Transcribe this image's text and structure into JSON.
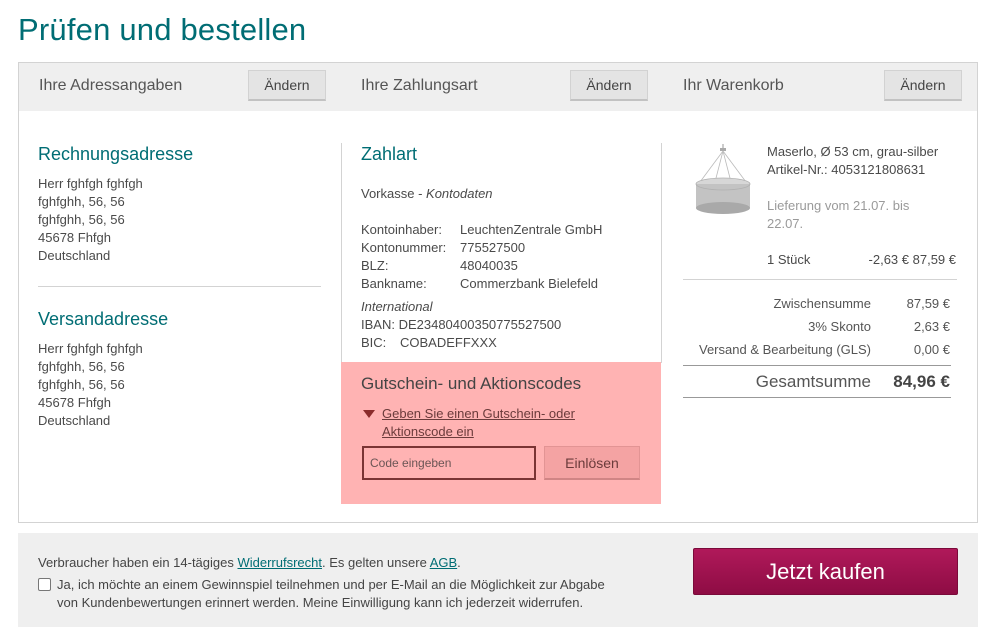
{
  "page_title": "Prüfen und bestellen",
  "steps": {
    "address_label": "Ihre Adressangaben",
    "payment_label": "Ihre Zahlungsart",
    "cart_label": "Ihr Warenkorb",
    "change_label": "Ändern"
  },
  "billing": {
    "heading": "Rechnungsadresse",
    "lines": [
      "Herr fghfgh fghfgh",
      "fghfghh, 56, 56",
      "fghfghh, 56, 56",
      "45678 Fhfgh",
      "Deutschland"
    ]
  },
  "shipping": {
    "heading": "Versandadresse",
    "lines": [
      "Herr fghfgh fghfgh",
      "fghfghh, 56, 56",
      "fghfghh, 56, 56",
      "45678 Fhfgh",
      "Deutschland"
    ]
  },
  "payment": {
    "heading": "Zahlart",
    "method": "Vorkasse - ",
    "method_detail": "Kontodaten",
    "rows": [
      {
        "label": "Kontoinhaber:",
        "value": "LeuchtenZentrale GmbH"
      },
      {
        "label": "Kontonummer:",
        "value": "775527500"
      },
      {
        "label": "BLZ:",
        "value": "48040035"
      },
      {
        "label": "Bankname:",
        "value": "Commerzbank Bielefeld"
      }
    ],
    "international_heading": "International",
    "iban": "IBAN: DE23480400350775527500",
    "bic_label": "BIC:",
    "bic_value": "COBADEFFXXX"
  },
  "coupon": {
    "heading": "Gutschein- und Aktionscodes",
    "link_line1": "Geben Sie einen Gutschein- oder",
    "link_line2": "Aktionscode ein",
    "placeholder": "Code eingeben",
    "redeem_label": "Einlösen",
    "arrow_icon": "triangle-down-icon"
  },
  "cart": {
    "product_name": "Maserlo, Ø 53 cm, grau-silber",
    "article_no": "Artikel-Nr.: 4053121808631",
    "delivery_line1": "Lieferung vom 21.07. bis",
    "delivery_line2": "22.07.",
    "quantity": "1 Stück",
    "price": "-2,63 € 87,59 €",
    "summary": [
      {
        "label": "Zwischensumme",
        "value": "87,59 €"
      },
      {
        "label": "3% Skonto",
        "value": "2,63 €"
      },
      {
        "label": "Versand & Bearbeitung (GLS)",
        "value": "0,00 €"
      }
    ],
    "total_label": "Gesamtsumme",
    "total_value": "84,96 €"
  },
  "footer": {
    "legal_prefix": "Verbraucher haben ein 14-tägiges ",
    "legal_link1": "Widerrufsrecht",
    "legal_middle": ". Es gelten unsere ",
    "legal_link2": "AGB",
    "legal_suffix": ".",
    "consent_line1": "Ja, ich möchte an einem Gewinnspiel teilnehmen und per E-Mail an die Möglichkeit zur Abgabe",
    "consent_line2": "von Kundenbewertungen erinnert werden. Meine Einwilligung kann ich jederzeit widerrufen.",
    "buy_label": "Jetzt kaufen"
  },
  "colors": {
    "accent": "#006d74",
    "buy_button": "#9e1250",
    "coupon_background": "#ffb3b3"
  }
}
